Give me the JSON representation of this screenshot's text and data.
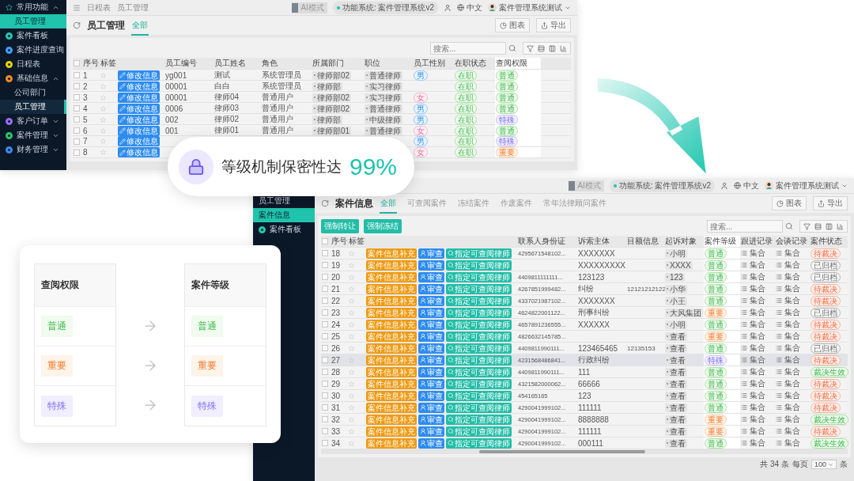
{
  "employee_window": {
    "sidebar": [
      {
        "label": "常用功能",
        "kind": "favorites",
        "expanded": true,
        "children": [
          {
            "label": "员工管理",
            "kind": "shortcut",
            "selected": true
          }
        ]
      },
      {
        "label": "案件看板",
        "color": "#1fc8b0",
        "selected": false
      },
      {
        "label": "案件进度查询",
        "color": "#3aa0ff",
        "selected": false
      },
      {
        "label": "日程表",
        "color": "#e8d000",
        "selected": false
      },
      {
        "label": "基础信息",
        "color": "#f08a24",
        "expanded": true,
        "children": [
          {
            "label": "公司部门",
            "kind": "page",
            "selected": false
          },
          {
            "label": "员工管理",
            "kind": "page",
            "selected": true
          }
        ]
      },
      {
        "label": "客户订单",
        "color": "#9b6cf0",
        "expanded": false
      },
      {
        "label": "案件管理",
        "color": "#2fc36b",
        "expanded": false
      },
      {
        "label": "财务管理",
        "color": "#3a8cf0",
        "expanded": false
      }
    ],
    "topbar": {
      "breadcrumbs": [
        "日程表",
        "员工管理"
      ],
      "mode": "AI模式",
      "system": "功能系统: 案件管理系统v2",
      "language": "中文",
      "user": "案件管理系统测试"
    },
    "title": "员工管理",
    "tabs": [
      {
        "label": "全部",
        "selected": true
      }
    ],
    "actions": [
      "图表",
      "导出"
    ],
    "search": {
      "placeholder": "搜索..."
    },
    "table": {
      "all_checked": false,
      "columns": [
        "序号",
        "标签",
        "员工编号",
        "员工姓名",
        "角色",
        "所属部门",
        "职位",
        "员工性别",
        "在职状态",
        "查阅权限"
      ],
      "rows": [
        {
          "index": "1",
          "checked": false,
          "action": "修改信息",
          "id": "yg001",
          "name": "测试",
          "role": "系统管理员",
          "dept": "律师部02",
          "position": "普通律师",
          "gender": {
            "label": "男",
            "kind": "male"
          },
          "status": "在职",
          "access": {
            "label": "普通",
            "kind": "normal"
          }
        },
        {
          "index": "2",
          "checked": false,
          "action": "修改信息",
          "id": "00001",
          "name": "白白",
          "role": "系统管理员",
          "dept": "律师部",
          "position": "实习律师",
          "status": "在职",
          "access": {
            "label": "普通",
            "kind": "normal"
          }
        },
        {
          "index": "3",
          "checked": false,
          "action": "修改信息",
          "id": "00001",
          "name": "律师04",
          "role": "普通用户",
          "dept": "律师部02",
          "position": "实习律师",
          "gender": {
            "label": "女",
            "kind": "female"
          },
          "status": "在职",
          "access": {
            "label": "普通",
            "kind": "normal"
          }
        },
        {
          "index": "4",
          "checked": false,
          "action": "修改信息",
          "id": "0006",
          "name": "律师03",
          "role": "普通用户",
          "dept": "律师部02",
          "position": "普通律师",
          "gender": {
            "label": "男",
            "kind": "male"
          },
          "status": "在职",
          "access": {
            "label": "普通",
            "kind": "normal"
          }
        },
        {
          "index": "5",
          "checked": false,
          "action": "修改信息",
          "id": "002",
          "name": "律师02",
          "role": "普通用户",
          "dept": "律师部",
          "position": "中级律师",
          "gender": {
            "label": "男",
            "kind": "male"
          },
          "status": "在职",
          "access": {
            "label": "特殊",
            "kind": "special"
          }
        },
        {
          "index": "6",
          "checked": false,
          "action": "修改信息",
          "id": "001",
          "name": "律师01",
          "role": "普通用户",
          "dept": "律师部01",
          "position": "普通律师",
          "gender": {
            "label": "女",
            "kind": "female"
          },
          "status": "在职",
          "access": {
            "label": "普通",
            "kind": "normal"
          }
        },
        {
          "index": "7",
          "checked": false,
          "action": "修改信息",
          "gender": {
            "label": "男",
            "kind": "male"
          },
          "status": "在职",
          "access": {
            "label": "特殊",
            "kind": "special"
          }
        },
        {
          "index": "8",
          "checked": false,
          "action": "修改信息",
          "gender": {
            "label": "女",
            "kind": "female"
          },
          "status": "在职",
          "access": {
            "label": "重要",
            "kind": "important"
          }
        }
      ]
    }
  },
  "case_window": {
    "sidebar": [
      {
        "label": "员工管理",
        "kind": "page",
        "selected": false
      },
      {
        "label": "案件信息",
        "kind": "shortcut",
        "selected": true
      },
      {
        "label": "案件看板",
        "color": "#1fc8b0",
        "selected": false
      }
    ],
    "topbar": {
      "mode": "AI模式",
      "system": "功能系统: 案件管理系统v2",
      "language": "中文",
      "user": "案件管理系统测试"
    },
    "title": "案件信息",
    "tabs": [
      {
        "label": "全部",
        "selected": true
      },
      {
        "label": "可查阅案件",
        "selected": false
      },
      {
        "label": "冻结案件",
        "selected": false
      },
      {
        "label": "作废案件",
        "selected": false
      },
      {
        "label": "常年法律顾问案件",
        "selected": false
      }
    ],
    "actions": [
      "图表",
      "导出"
    ],
    "bulk_actions": [
      "强制转让",
      "强制冻结"
    ],
    "search": {
      "placeholder": "搜索..."
    },
    "table": {
      "all_checked": false,
      "columns": [
        "序号",
        "标签",
        "联系人身份证",
        "诉索主体",
        "目额信息",
        "起诉对象",
        "案件等级",
        "跟进记录",
        "会谈记录",
        "案件状态"
      ],
      "rows": [
        {
          "index": "18",
          "checked": false,
          "selected": false,
          "actions": [
            "案件信息补充",
            "审查",
            "指定可查阅律师"
          ],
          "id_card": "4295671548102...",
          "subject": "XXXXXXX",
          "defendant": "小明",
          "grade": {
            "label": "普通",
            "kind": "normal"
          },
          "follow_up": "集合",
          "meeting": "集合",
          "status": {
            "label": "待裁决",
            "kind": "pending"
          }
        },
        {
          "index": "19",
          "checked": false,
          "selected": false,
          "actions": [
            "案件信息补充",
            "审查",
            "指定可查阅律师"
          ],
          "subject": "XXXXXXXXX",
          "defendant": "XXXX",
          "grade": {
            "label": "普通",
            "kind": "normal"
          },
          "follow_up": "集合",
          "meeting": "集合",
          "status": {
            "label": "已归档",
            "kind": "archived"
          }
        },
        {
          "index": "20",
          "checked": false,
          "selected": false,
          "actions": [
            "案件信息补充",
            "审查",
            "指定可查阅律师"
          ],
          "id_card": "4409811111111...",
          "subject": "123123",
          "defendant": "123",
          "grade": {
            "label": "普通",
            "kind": "normal"
          },
          "follow_up": "集合",
          "meeting": "集合",
          "status": {
            "label": "已归档",
            "kind": "archived"
          }
        },
        {
          "index": "21",
          "checked": false,
          "selected": false,
          "actions": [
            "案件信息补充",
            "审查",
            "指定可查阅律师"
          ],
          "id_card": "4267851999482...",
          "subject": "纠纷",
          "amount": "12121212122",
          "defendant": "小华",
          "grade": {
            "label": "普通",
            "kind": "normal"
          },
          "follow_up": "集合",
          "meeting": "集合",
          "status": {
            "label": "待裁决",
            "kind": "pending"
          }
        },
        {
          "index": "22",
          "checked": false,
          "selected": false,
          "actions": [
            "案件信息补充",
            "审查",
            "指定可查阅律师"
          ],
          "id_card": "4337021987102...",
          "subject": "XXXXXXX",
          "defendant": "小王",
          "grade": {
            "label": "普通",
            "kind": "normal"
          },
          "follow_up": "集合",
          "meeting": "集合",
          "status": {
            "label": "待裁决",
            "kind": "pending"
          }
        },
        {
          "index": "23",
          "checked": false,
          "selected": false,
          "actions": [
            "案件信息补充",
            "审查",
            "指定可查阅律师"
          ],
          "id_card": "4624822001122...",
          "subject": "刑事纠纷",
          "defendant": "大风集团",
          "grade": {
            "label": "重要",
            "kind": "important"
          },
          "follow_up": "集合",
          "meeting": "集合",
          "status": {
            "label": "已归档",
            "kind": "archived"
          }
        },
        {
          "index": "24",
          "checked": false,
          "selected": false,
          "actions": [
            "案件信息补充",
            "审查",
            "指定可查阅律师"
          ],
          "id_card": "4657891236555...",
          "subject": "XXXXXX",
          "defendant": "小明",
          "grade": {
            "label": "普通",
            "kind": "normal"
          },
          "follow_up": "集合",
          "meeting": "集合",
          "status": {
            "label": "待裁决",
            "kind": "pending"
          }
        },
        {
          "index": "25",
          "checked": false,
          "selected": false,
          "actions": [
            "案件信息补充",
            "审查",
            "指定可查阅律师"
          ],
          "id_card": "4826632145785...",
          "defendant": "查看",
          "grade": {
            "label": "重要",
            "kind": "important"
          },
          "follow_up": "集合",
          "meeting": "集合",
          "status": {
            "label": "待裁决",
            "kind": "pending"
          }
        },
        {
          "index": "26",
          "checked": false,
          "selected": false,
          "actions": [
            "案件信息补充",
            "审查",
            "指定可查阅律师"
          ],
          "id_card": "4409811990111...",
          "subject": "123465465",
          "amount": "12135153",
          "defendant": "查看",
          "grade": {
            "label": "普通",
            "kind": "normal"
          },
          "follow_up": "集合",
          "meeting": "集合",
          "status": {
            "label": "已归档",
            "kind": "archived"
          }
        },
        {
          "index": "27",
          "checked": false,
          "selected": true,
          "actions": [
            "案件信息补充",
            "审查",
            "指定可查阅律师"
          ],
          "id_card": "4231568486841...",
          "subject": "行政纠纷",
          "defendant": "查看",
          "grade": {
            "label": "特殊",
            "kind": "special"
          },
          "follow_up": "集合",
          "meeting": "集合",
          "status": {
            "label": "待裁决",
            "kind": "pending"
          }
        },
        {
          "index": "28",
          "checked": false,
          "selected": false,
          "actions": [
            "案件信息补充",
            "审查",
            "指定可查阅律师"
          ],
          "id_card": "4409811990111...",
          "subject": "111",
          "defendant": "查看",
          "grade": {
            "label": "普通",
            "kind": "normal"
          },
          "follow_up": "集合",
          "meeting": "集合",
          "status": {
            "label": "裁决生效",
            "kind": "effective"
          }
        },
        {
          "index": "29",
          "checked": false,
          "selected": false,
          "actions": [
            "案件信息补充",
            "审查",
            "指定可查阅律师"
          ],
          "id_card": "4321582000062...",
          "subject": "66666",
          "defendant": "查看",
          "grade": {
            "label": "普通",
            "kind": "normal"
          },
          "follow_up": "集合",
          "meeting": "集合",
          "status": {
            "label": "待裁决",
            "kind": "pending"
          }
        },
        {
          "index": "30",
          "checked": false,
          "selected": false,
          "actions": [
            "案件信息补充",
            "审查",
            "指定可查阅律师"
          ],
          "id_card": "454165165",
          "subject": "123",
          "defendant": "查看",
          "grade": {
            "label": "普通",
            "kind": "normal"
          },
          "follow_up": "集合",
          "meeting": "集合",
          "status": {
            "label": "待裁决",
            "kind": "pending"
          }
        },
        {
          "index": "31",
          "checked": false,
          "selected": false,
          "actions": [
            "案件信息补充",
            "审查",
            "指定可查阅律师"
          ],
          "id_card": "4290041999102...",
          "subject": "111111",
          "defendant": "查看",
          "grade": {
            "label": "普通",
            "kind": "normal"
          },
          "follow_up": "集合",
          "meeting": "集合",
          "status": {
            "label": "待裁决",
            "kind": "pending"
          }
        },
        {
          "index": "32",
          "checked": false,
          "selected": false,
          "actions": [
            "案件信息补充",
            "审查",
            "指定可查阅律师"
          ],
          "id_card": "4290041999102...",
          "subject": "8888888",
          "defendant": "查看",
          "grade": {
            "label": "重要",
            "kind": "important"
          },
          "follow_up": "集合",
          "meeting": "集合",
          "status": {
            "label": "裁决生效",
            "kind": "effective"
          }
        },
        {
          "index": "33",
          "checked": false,
          "selected": false,
          "actions": [
            "案件信息补充",
            "审查",
            "指定可查阅律师"
          ],
          "id_card": "4290041999102...",
          "subject": "111111",
          "defendant": "查看",
          "grade": {
            "label": "重要",
            "kind": "important"
          },
          "follow_up": "集合",
          "meeting": "集合",
          "status": {
            "label": "待裁决",
            "kind": "pending"
          }
        },
        {
          "index": "34",
          "checked": false,
          "selected": false,
          "actions": [
            "案件信息补充",
            "审查",
            "指定可查阅律师"
          ],
          "id_card": "4290041999102...",
          "subject": "000111",
          "defendant": "查看",
          "grade": {
            "label": "普通",
            "kind": "normal"
          },
          "follow_up": "集合",
          "meeting": "集合",
          "status": {
            "label": "裁决生效",
            "kind": "effective"
          }
        }
      ]
    },
    "footer": {
      "total": "共 34 条",
      "per_page_label": "每页",
      "per_page": "100",
      "unit": "条"
    }
  },
  "badge": {
    "text": "等级机制保密性达",
    "value": "99%"
  },
  "mapping": {
    "headers": [
      "查阅权限",
      "案件等级"
    ],
    "rows": [
      {
        "from": {
          "label": "普通",
          "kind": "normal"
        },
        "to": {
          "label": "普通",
          "kind": "normal"
        }
      },
      {
        "from": {
          "label": "重要",
          "kind": "important"
        },
        "to": {
          "label": "重要",
          "kind": "important"
        }
      },
      {
        "from": {
          "label": "特殊",
          "kind": "special"
        },
        "to": {
          "label": "特殊",
          "kind": "special"
        }
      }
    ]
  }
}
